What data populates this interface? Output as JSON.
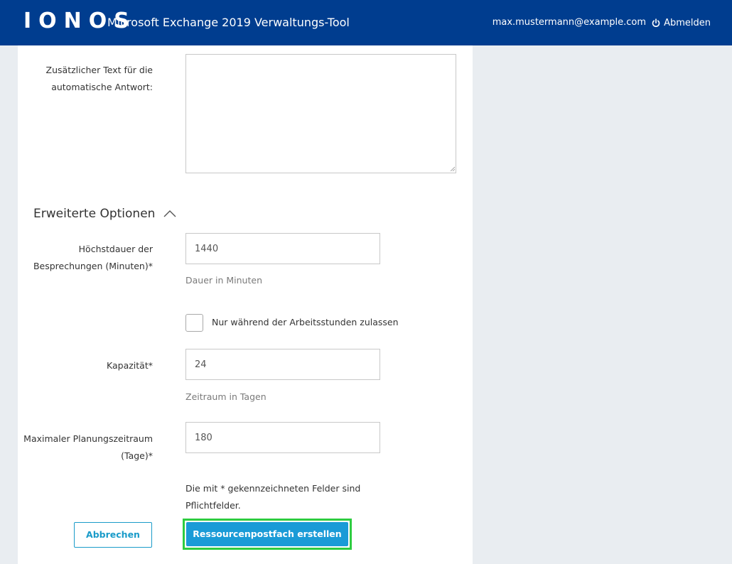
{
  "header": {
    "logo": "IONOS",
    "title": "Microsoft Exchange 2019 Verwaltungs-Tool",
    "user_email": "max.mustermann@example.com",
    "logout_label": "Abmelden",
    "logout_icon": "power-icon"
  },
  "form": {
    "auto_reply_label": "Zusätzlicher Text für die automatische Antwort:",
    "auto_reply_value": "",
    "advanced_section_title": "Erweiterte Optionen",
    "advanced_section_icon": "chevron-up-icon",
    "max_duration_label": "Höchstdauer der Besprechungen (Minuten)*",
    "max_duration_value": "1440",
    "max_duration_hint": "Dauer in Minuten",
    "working_hours_only_label": "Nur während der Arbeitsstunden zulassen",
    "working_hours_only_checked": false,
    "capacity_label": "Kapazität*",
    "capacity_value": "24",
    "capacity_hint": "Zeitraum in Tagen",
    "max_planning_label": "Maximaler Planungszeitraum (Tage)*",
    "max_planning_value": "180",
    "required_note": "Die mit * gekennzeichneten Felder sind Pflichtfelder.",
    "cancel_label": "Abbrechen",
    "submit_label": "Ressourcenpostfach erstellen"
  },
  "colors": {
    "header_bg": "#003d8f",
    "page_bg": "#e9edf1",
    "primary_button": "#1a9bd7",
    "highlight_border": "#2ecc40"
  }
}
